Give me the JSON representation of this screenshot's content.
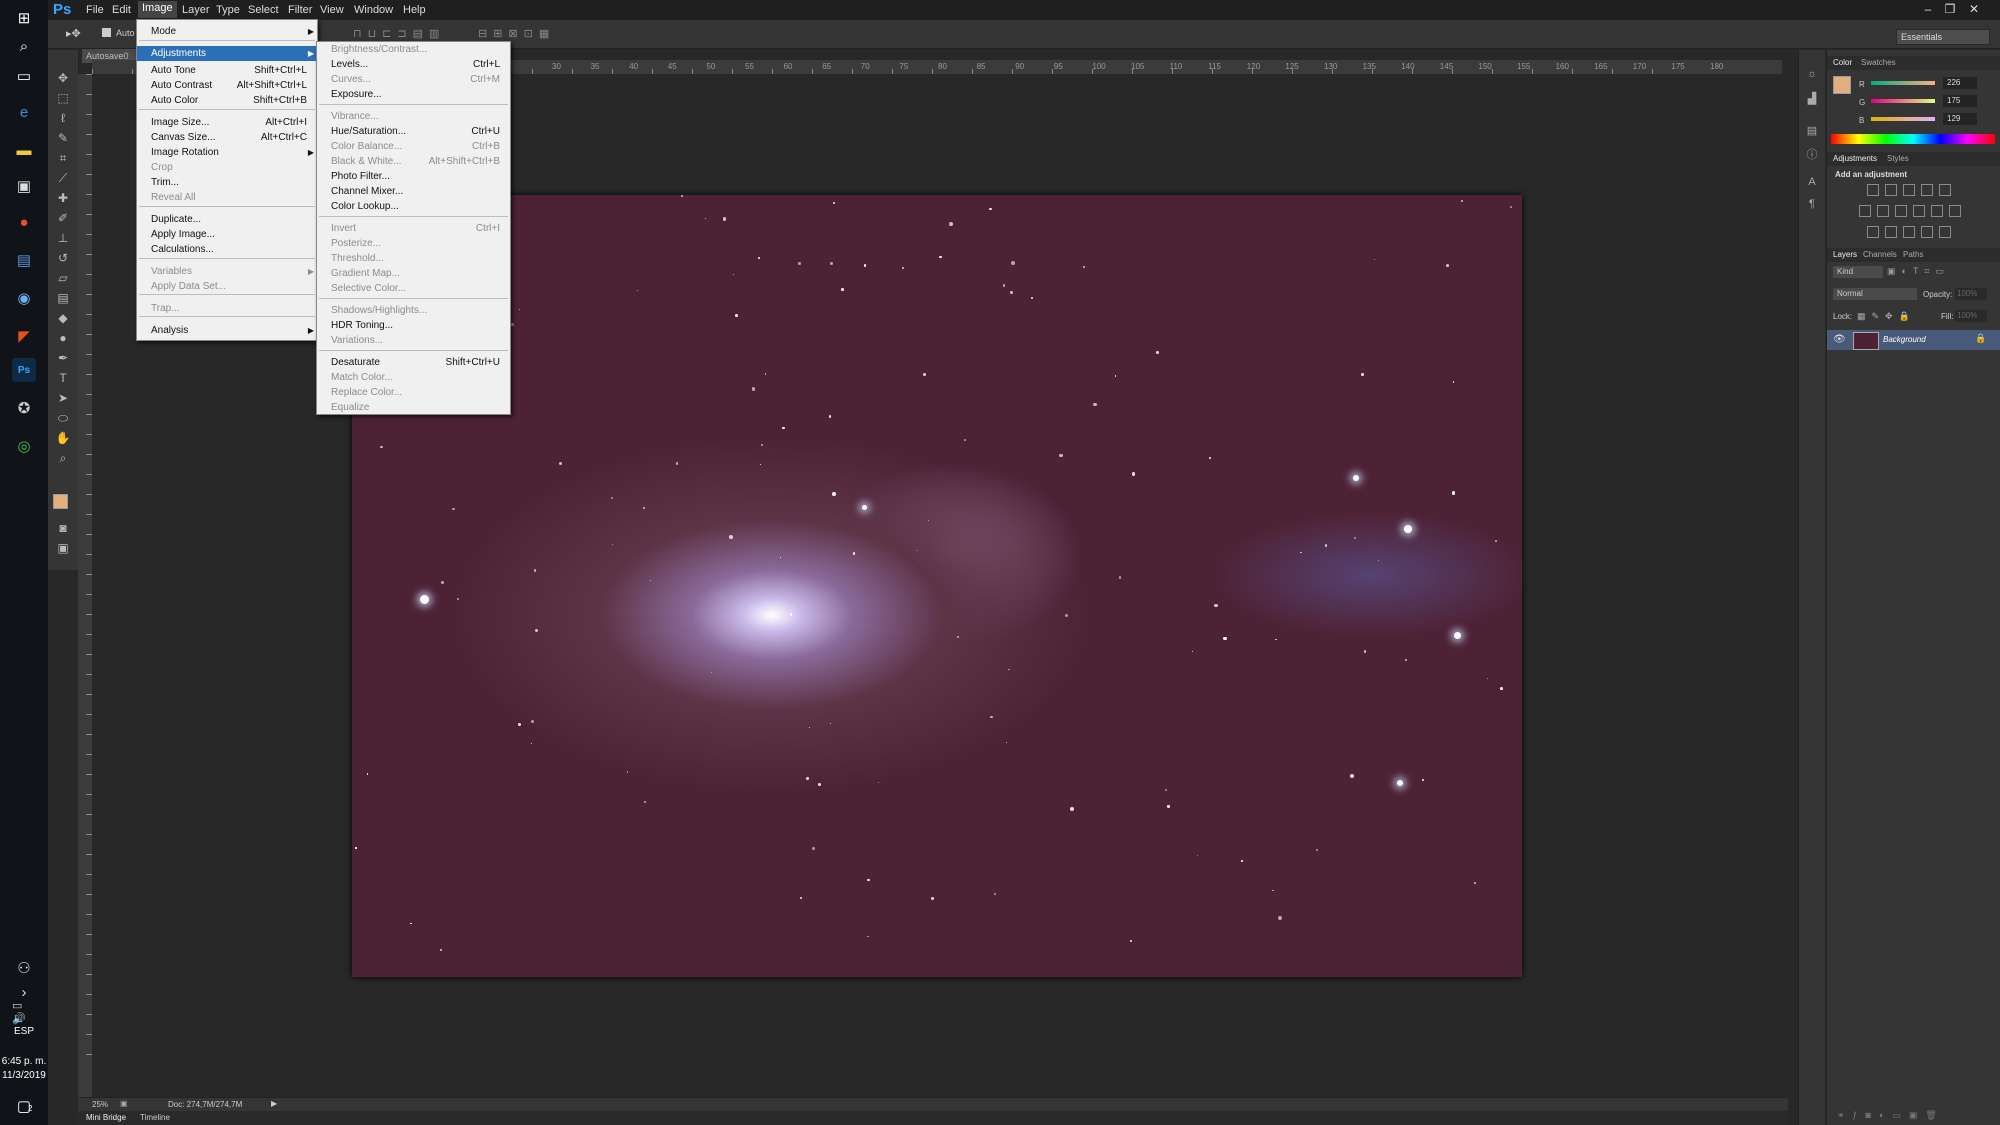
{
  "app": {
    "logo": "Ps"
  },
  "menubar": {
    "items": [
      "File",
      "Edit",
      "Image",
      "Layer",
      "Type",
      "Select",
      "Filter",
      "View",
      "Window",
      "Help"
    ],
    "active": "Image"
  },
  "optionsbar": {
    "auto_label": "Auto",
    "workspace": "Essentials"
  },
  "document": {
    "tab_label": "Autosave0"
  },
  "image_menu": {
    "items": [
      {
        "label": "Mode",
        "shortcut": "",
        "submenu": true,
        "disabled": false
      },
      {
        "label": "Adjustments",
        "shortcut": "",
        "submenu": true,
        "disabled": false,
        "highlighted": true
      },
      {
        "label": "Auto Tone",
        "shortcut": "Shift+Ctrl+L",
        "disabled": false
      },
      {
        "label": "Auto Contrast",
        "shortcut": "Alt+Shift+Ctrl+L",
        "disabled": false
      },
      {
        "label": "Auto Color",
        "shortcut": "Shift+Ctrl+B",
        "disabled": false
      },
      {
        "label": "Image Size...",
        "shortcut": "Alt+Ctrl+I",
        "disabled": false
      },
      {
        "label": "Canvas Size...",
        "shortcut": "Alt+Ctrl+C",
        "disabled": false
      },
      {
        "label": "Image Rotation",
        "shortcut": "",
        "submenu": true,
        "disabled": false
      },
      {
        "label": "Crop",
        "shortcut": "",
        "disabled": true
      },
      {
        "label": "Trim...",
        "shortcut": "",
        "disabled": false
      },
      {
        "label": "Reveal All",
        "shortcut": "",
        "disabled": true
      },
      {
        "label": "Duplicate...",
        "shortcut": "",
        "disabled": false
      },
      {
        "label": "Apply Image...",
        "shortcut": "",
        "disabled": false
      },
      {
        "label": "Calculations...",
        "shortcut": "",
        "disabled": false
      },
      {
        "label": "Variables",
        "shortcut": "",
        "submenu": true,
        "disabled": true
      },
      {
        "label": "Apply Data Set...",
        "shortcut": "",
        "disabled": true
      },
      {
        "label": "Trap...",
        "shortcut": "",
        "disabled": true
      },
      {
        "label": "Analysis",
        "shortcut": "",
        "submenu": true,
        "disabled": false
      }
    ]
  },
  "adjustments_menu": {
    "items": [
      {
        "label": "Brightness/Contrast...",
        "shortcut": "",
        "disabled": true
      },
      {
        "label": "Levels...",
        "shortcut": "Ctrl+L",
        "disabled": false
      },
      {
        "label": "Curves...",
        "shortcut": "Ctrl+M",
        "disabled": true
      },
      {
        "label": "Exposure...",
        "shortcut": "",
        "disabled": false
      },
      {
        "label": "Vibrance...",
        "shortcut": "",
        "disabled": true
      },
      {
        "label": "Hue/Saturation...",
        "shortcut": "Ctrl+U",
        "disabled": false
      },
      {
        "label": "Color Balance...",
        "shortcut": "Ctrl+B",
        "disabled": true
      },
      {
        "label": "Black & White...",
        "shortcut": "Alt+Shift+Ctrl+B",
        "disabled": true
      },
      {
        "label": "Photo Filter...",
        "shortcut": "",
        "disabled": false
      },
      {
        "label": "Channel Mixer...",
        "shortcut": "",
        "disabled": false
      },
      {
        "label": "Color Lookup...",
        "shortcut": "",
        "disabled": false
      },
      {
        "label": "Invert",
        "shortcut": "Ctrl+I",
        "disabled": true
      },
      {
        "label": "Posterize...",
        "shortcut": "",
        "disabled": true
      },
      {
        "label": "Threshold...",
        "shortcut": "",
        "disabled": true
      },
      {
        "label": "Gradient Map...",
        "shortcut": "",
        "disabled": true
      },
      {
        "label": "Selective Color...",
        "shortcut": "",
        "disabled": true
      },
      {
        "label": "Shadows/Highlights...",
        "shortcut": "",
        "disabled": true
      },
      {
        "label": "HDR Toning...",
        "shortcut": "",
        "disabled": false
      },
      {
        "label": "Variations...",
        "shortcut": "",
        "disabled": true
      },
      {
        "label": "Desaturate",
        "shortcut": "Shift+Ctrl+U",
        "disabled": false
      },
      {
        "label": "Match Color...",
        "shortcut": "",
        "disabled": true
      },
      {
        "label": "Replace Color...",
        "shortcut": "",
        "disabled": true
      },
      {
        "label": "Equalize",
        "shortcut": "",
        "disabled": true
      }
    ]
  },
  "rulers": {
    "h_ticks": [
      "30",
      "35",
      "40",
      "45",
      "50",
      "55",
      "60",
      "65",
      "70",
      "75",
      "80",
      "85",
      "90",
      "95",
      "100",
      "105",
      "110",
      "115",
      "120",
      "125",
      "130",
      "135",
      "140",
      "145",
      "150",
      "155",
      "160",
      "165",
      "170",
      "175",
      "180"
    ]
  },
  "statusbar": {
    "zoom": "25%",
    "doc_info": "Doc: 274,7M/274,7M"
  },
  "bottom_tabs": [
    "Mini Bridge",
    "Timeline"
  ],
  "color_panel": {
    "tabs": [
      "Color",
      "Swatches"
    ],
    "channels": [
      {
        "label": "R",
        "value": "226"
      },
      {
        "label": "G",
        "value": "175"
      },
      {
        "label": "B",
        "value": "129"
      }
    ],
    "fg_color": "#e2af81"
  },
  "adjustments_panel": {
    "tabs": [
      "Adjustments",
      "Styles"
    ],
    "heading": "Add an adjustment"
  },
  "layers_panel": {
    "tabs": [
      "Layers",
      "Channels",
      "Paths"
    ],
    "kind_label": "Kind",
    "blend_mode": "Normal",
    "opacity_label": "Opacity:",
    "opacity_value": "100%",
    "lock_label": "Lock:",
    "fill_label": "Fill:",
    "fill_value": "100%",
    "layer_name": "Background"
  },
  "taskbar": {
    "lang": "ESP",
    "time": "6:45 p. m.",
    "date": "11/3/2019",
    "notification_count": "2"
  }
}
